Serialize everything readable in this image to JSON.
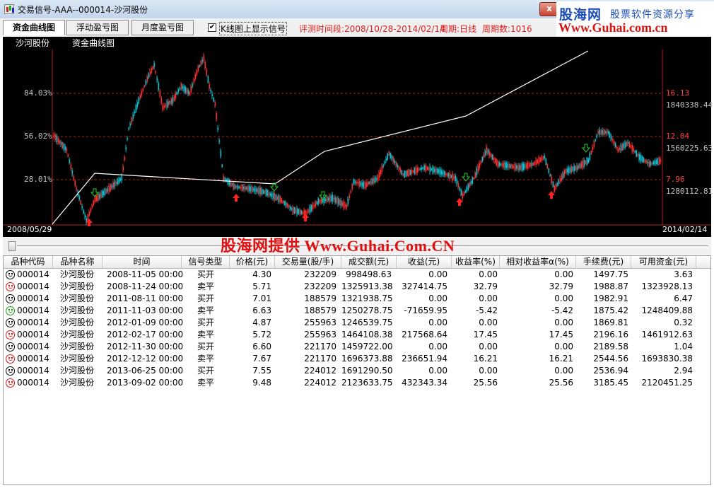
{
  "window": {
    "title": "交易信号-AAA--000014-沙河股份",
    "close_label": "x"
  },
  "logo": {
    "brand": "股海网",
    "slogan": "股票软件资源分享",
    "url": "Www.Guhai.com.cn"
  },
  "tabs": [
    {
      "label": "资金曲线图",
      "active": true
    },
    {
      "label": "浮动盈亏图",
      "active": false
    },
    {
      "label": "月度盈亏图",
      "active": false
    }
  ],
  "toolbar": {
    "checkbox_label": "K线图上显示信号",
    "checkbox_checked": true,
    "period_text": "评测时间段:2008/10/28-2014/02/14",
    "cycle_text": "周期:日线",
    "count_text": "周期数:1016"
  },
  "chart": {
    "caption_stock": "沙河股份",
    "caption_curve": "资金曲线图",
    "left_pct_labels": [
      "84.03%",
      "56.02%",
      "28.01%"
    ],
    "right_price_labels": [
      "16.13",
      "12.04",
      "7.96"
    ],
    "right_capital_labels": [
      "1840338.44",
      "1560225.63",
      "1280112.81"
    ],
    "start_date": "2008/05/29",
    "end_date": "2014/02/14"
  },
  "chart_data": {
    "type": "line",
    "series": [
      {
        "values": [
          1000000,
          1323928,
          1248409,
          1461913,
          1693830,
          2120451
        ]
      }
    ],
    "signals": {
      "buy_dates": [
        "2008-11-05",
        "2011-08-11",
        "2012-01-09",
        "2012-11-30",
        "2013-06-25"
      ],
      "sell_dates": [
        "2008-11-24",
        "2011-11-03",
        "2012-02-17",
        "2012-12-12",
        "2013-09-02"
      ]
    },
    "left_axis_ticks": [
      "84.03%",
      "56.02%",
      "28.01%"
    ],
    "right_axis_price_ticks": [
      16.13,
      12.04,
      7.96
    ],
    "right_axis_capital_ticks": [
      1840338.44,
      1560225.63,
      1280112.81
    ],
    "x_range": [
      "2008/05/29",
      "2014/02/14"
    ],
    "colors": {
      "background": "#000000",
      "equity_line": "#ffffff",
      "grid": "#b02020",
      "up_candle": "#ff3030",
      "down_candle": "#00c8d8",
      "buy_arrow": "#ff2020",
      "sell_arrow": "#20d020"
    }
  },
  "watermark": "股海网提供 Www.Guhai.Com.CN",
  "table": {
    "headers": [
      "品种代码",
      "品种名称",
      "时间",
      "信号类型",
      "价格(元)",
      "交易量(股/手)",
      "成交额(元)",
      "收益(元)",
      "收益率(%)",
      "相对收益率α(%)",
      "手续费(元)",
      "可用资金(元)"
    ],
    "rows": [
      {
        "face": "black",
        "code": "000014",
        "name": "沙河股份",
        "time": "2008-11-05 00:00",
        "type": "买开",
        "price": "4.30",
        "volume": "232209",
        "amount": "998498.63",
        "profit": "0.00",
        "rate": "0.00",
        "alpha": "0.00",
        "fee": "1497.75",
        "cash": "3.63"
      },
      {
        "face": "red",
        "code": "000014",
        "name": "沙河股份",
        "time": "2008-11-24 00:00",
        "type": "卖平",
        "price": "5.71",
        "volume": "232209",
        "amount": "1325913.38",
        "profit": "327414.75",
        "rate": "32.79",
        "alpha": "32.79",
        "fee": "1988.87",
        "cash": "1323928.13"
      },
      {
        "face": "black",
        "code": "000014",
        "name": "沙河股份",
        "time": "2011-08-11 00:00",
        "type": "买开",
        "price": "7.01",
        "volume": "188579",
        "amount": "1321938.75",
        "profit": "0.00",
        "rate": "0.00",
        "alpha": "0.00",
        "fee": "1982.91",
        "cash": "6.47"
      },
      {
        "face": "green",
        "code": "000014",
        "name": "沙河股份",
        "time": "2011-11-03 00:00",
        "type": "卖平",
        "price": "6.63",
        "volume": "188579",
        "amount": "1250278.75",
        "profit": "-71659.95",
        "rate": "-5.42",
        "alpha": "-5.42",
        "fee": "1875.42",
        "cash": "1248409.88"
      },
      {
        "face": "black",
        "code": "000014",
        "name": "沙河股份",
        "time": "2012-01-09 00:00",
        "type": "买开",
        "price": "4.87",
        "volume": "255963",
        "amount": "1246539.75",
        "profit": "0.00",
        "rate": "0.00",
        "alpha": "0.00",
        "fee": "1869.81",
        "cash": "0.32"
      },
      {
        "face": "red",
        "code": "000014",
        "name": "沙河股份",
        "time": "2012-02-17 00:00",
        "type": "卖平",
        "price": "5.72",
        "volume": "255963",
        "amount": "1464108.38",
        "profit": "217568.64",
        "rate": "17.45",
        "alpha": "17.45",
        "fee": "2196.16",
        "cash": "1461912.63"
      },
      {
        "face": "black",
        "code": "000014",
        "name": "沙河股份",
        "time": "2012-11-30 00:00",
        "type": "买开",
        "price": "6.60",
        "volume": "221170",
        "amount": "1459722.00",
        "profit": "0.00",
        "rate": "0.00",
        "alpha": "0.00",
        "fee": "2189.58",
        "cash": "1.04"
      },
      {
        "face": "red",
        "code": "000014",
        "name": "沙河股份",
        "time": "2012-12-12 00:00",
        "type": "卖平",
        "price": "7.67",
        "volume": "221170",
        "amount": "1696373.88",
        "profit": "236651.94",
        "rate": "16.21",
        "alpha": "16.21",
        "fee": "2544.56",
        "cash": "1693830.38"
      },
      {
        "face": "black",
        "code": "000014",
        "name": "沙河股份",
        "time": "2013-06-25 00:00",
        "type": "买开",
        "price": "7.55",
        "volume": "224012",
        "amount": "1691290.50",
        "profit": "0.00",
        "rate": "0.00",
        "alpha": "0.00",
        "fee": "2536.94",
        "cash": "2.94"
      },
      {
        "face": "red",
        "code": "000014",
        "name": "沙河股份",
        "time": "2013-09-02 00:00",
        "type": "卖平",
        "price": "9.48",
        "volume": "224012",
        "amount": "2123633.75",
        "profit": "432343.34",
        "rate": "25.56",
        "alpha": "25.56",
        "fee": "3185.45",
        "cash": "2120451.25"
      }
    ]
  }
}
